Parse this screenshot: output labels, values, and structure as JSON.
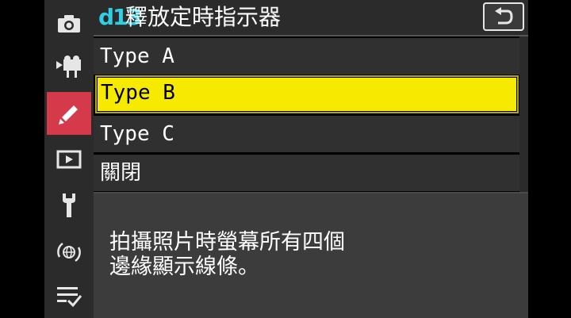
{
  "sidebar": {
    "items": [
      {
        "icon": "camera-icon",
        "active": false
      },
      {
        "icon": "video-camera-icon",
        "active": false
      },
      {
        "icon": "pencil-icon",
        "active": true
      },
      {
        "icon": "playback-icon",
        "active": false
      },
      {
        "icon": "wrench-icon",
        "active": false
      },
      {
        "icon": "network-icon",
        "active": false
      },
      {
        "icon": "my-menu-icon",
        "active": false
      }
    ]
  },
  "header": {
    "code": "d13",
    "title": "釋放定時指示器",
    "back_icon": "back-arrow-icon"
  },
  "options": [
    {
      "label": "Type A",
      "selected": false
    },
    {
      "label": "Type B",
      "selected": true
    },
    {
      "label": "Type C",
      "selected": false
    },
    {
      "label": "關閉",
      "selected": false
    }
  ],
  "help": {
    "line1": "拍攝照片時螢幕所有四個",
    "line2": "邊緣顯示線條。"
  },
  "colors": {
    "accent_active": "#d43a4a",
    "selection": "#f6ea00",
    "code_color": "#2fd0e6"
  }
}
